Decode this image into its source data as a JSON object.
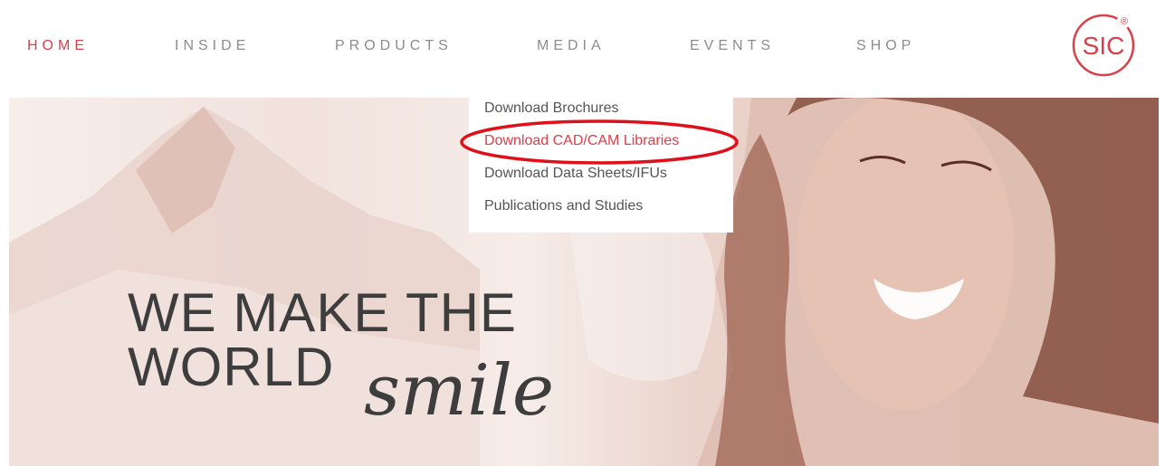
{
  "nav": {
    "items": [
      {
        "label": "HOME",
        "active": true
      },
      {
        "label": "INSIDE",
        "active": false
      },
      {
        "label": "PRODUCTS",
        "active": false
      },
      {
        "label": "MEDIA",
        "active": false
      },
      {
        "label": "EVENTS",
        "active": false
      },
      {
        "label": "SHOP",
        "active": false
      }
    ]
  },
  "logo": {
    "text": "SIC",
    "registered": "®",
    "color": "#d8404a"
  },
  "dropdown": {
    "items": [
      {
        "label": "Download Brochures"
      },
      {
        "label": "Download CAD/CAM Libraries",
        "highlighted": true
      },
      {
        "label": "Download Data Sheets/IFUs"
      },
      {
        "label": "Publications and Studies"
      }
    ]
  },
  "hero": {
    "headline_line1": "WE MAKE THE",
    "headline_line2": "WORLD",
    "headline_script": "smile"
  },
  "colors": {
    "accent": "#d8404a",
    "nav_text": "#8c8c8c",
    "headline": "#3d3d3d",
    "annotation": "#e0101a"
  }
}
